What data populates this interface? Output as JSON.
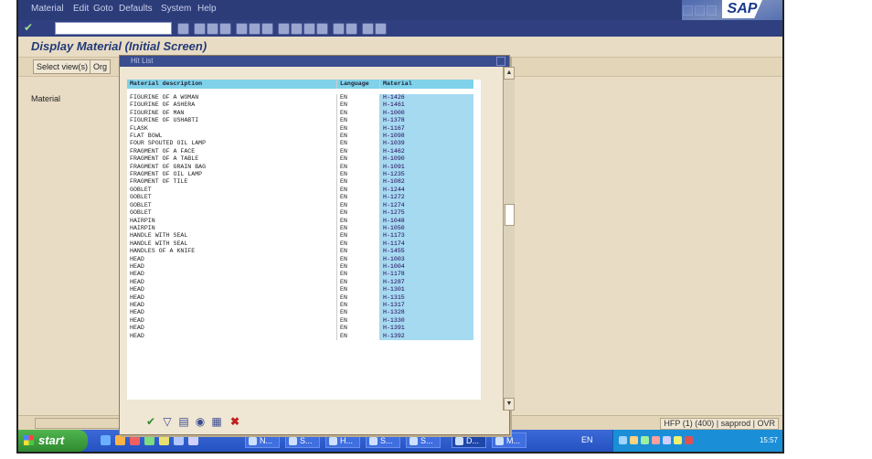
{
  "menubar": {
    "items": [
      "Material",
      "Edit",
      "Goto",
      "Defaults",
      "System",
      "Help"
    ],
    "logo": "SAP"
  },
  "toolbar": {
    "icons": [
      "check-icon",
      "save-icon",
      "back-icon",
      "exit-icon",
      "cancel-icon",
      "print-icon",
      "find-icon",
      "find-next-icon",
      "first-page-icon",
      "prev-page-icon",
      "next-page-icon",
      "last-page-icon",
      "new-session-icon",
      "shortcut-icon",
      "help-icon",
      "layout-icon"
    ]
  },
  "title": "Display Material (Initial Screen)",
  "appbar": {
    "select_views": "Select view(s)",
    "org_levels": "Org"
  },
  "main": {
    "material_label": "Material"
  },
  "popup": {
    "title": "Hit List",
    "columns": [
      "Material description",
      "Language",
      "Material"
    ],
    "rows": [
      [
        "FIGURINE OF A WOMAN",
        "EN",
        "H-1426"
      ],
      [
        "FIGURINE OF ASHERA",
        "EN",
        "H-1461"
      ],
      [
        "FIGURINE OF MAN",
        "EN",
        "H-1000"
      ],
      [
        "FIGURINE OF USHABTI",
        "EN",
        "H-1378"
      ],
      [
        "FLASK",
        "EN",
        "H-1167"
      ],
      [
        "FLAT BOWL",
        "EN",
        "H-1098"
      ],
      [
        "FOUR SPOUTED OIL LAMP",
        "EN",
        "H-1039"
      ],
      [
        "FRAGMENT OF A FACE",
        "EN",
        "H-1462"
      ],
      [
        "FRAGMENT OF A TABLE",
        "EN",
        "H-1090"
      ],
      [
        "FRAGMENT OF GRAIN BAG",
        "EN",
        "H-1091"
      ],
      [
        "FRAGMENT OF OIL LAMP",
        "EN",
        "H-1235"
      ],
      [
        "FRAGMENT OF TILE",
        "EN",
        "H-1082"
      ],
      [
        "GOBLET",
        "EN",
        "H-1244"
      ],
      [
        "GOBLET",
        "EN",
        "H-1272"
      ],
      [
        "GOBLET",
        "EN",
        "H-1274"
      ],
      [
        "GOBLET",
        "EN",
        "H-1275"
      ],
      [
        "HAIRPIN",
        "EN",
        "H-1048"
      ],
      [
        "HAIRPIN",
        "EN",
        "H-1050"
      ],
      [
        "HANDLE WITH SEAL",
        "EN",
        "H-1173"
      ],
      [
        "HANDLE WITH SEAL",
        "EN",
        "H-1174"
      ],
      [
        "HANDLES OF A KNIFE",
        "EN",
        "H-1455"
      ],
      [
        "HEAD",
        "EN",
        "H-1003"
      ],
      [
        "HEAD",
        "EN",
        "H-1004"
      ],
      [
        "HEAD",
        "EN",
        "H-1178"
      ],
      [
        "HEAD",
        "EN",
        "H-1287"
      ],
      [
        "HEAD",
        "EN",
        "H-1301"
      ],
      [
        "HEAD",
        "EN",
        "H-1315"
      ],
      [
        "HEAD",
        "EN",
        "H-1317"
      ],
      [
        "HEAD",
        "EN",
        "H-1328"
      ],
      [
        "HEAD",
        "EN",
        "H-1330"
      ],
      [
        "HEAD",
        "EN",
        "H-1391"
      ],
      [
        "HEAD",
        "EN",
        "H-1392"
      ]
    ],
    "toolbar_icons": [
      "check-icon",
      "filter-icon",
      "sort-icon",
      "find-icon",
      "select-icon",
      "cancel-icon"
    ]
  },
  "statusbar": {
    "system_info": "HFP (1) (400)",
    "server": "sapprod",
    "mode": "OVR"
  },
  "taskbar": {
    "start": "start",
    "tasks": [
      "N...",
      "S...",
      "H...",
      "S...",
      "S...",
      "D...",
      "M..."
    ],
    "language": "EN",
    "clock": "15:57"
  },
  "colors": {
    "sap_blue": "#2b3c79",
    "bg_tan": "#e9dcc4",
    "highlight_cyan": "#7fd2ea",
    "taskbar_blue": "#2452c0"
  }
}
